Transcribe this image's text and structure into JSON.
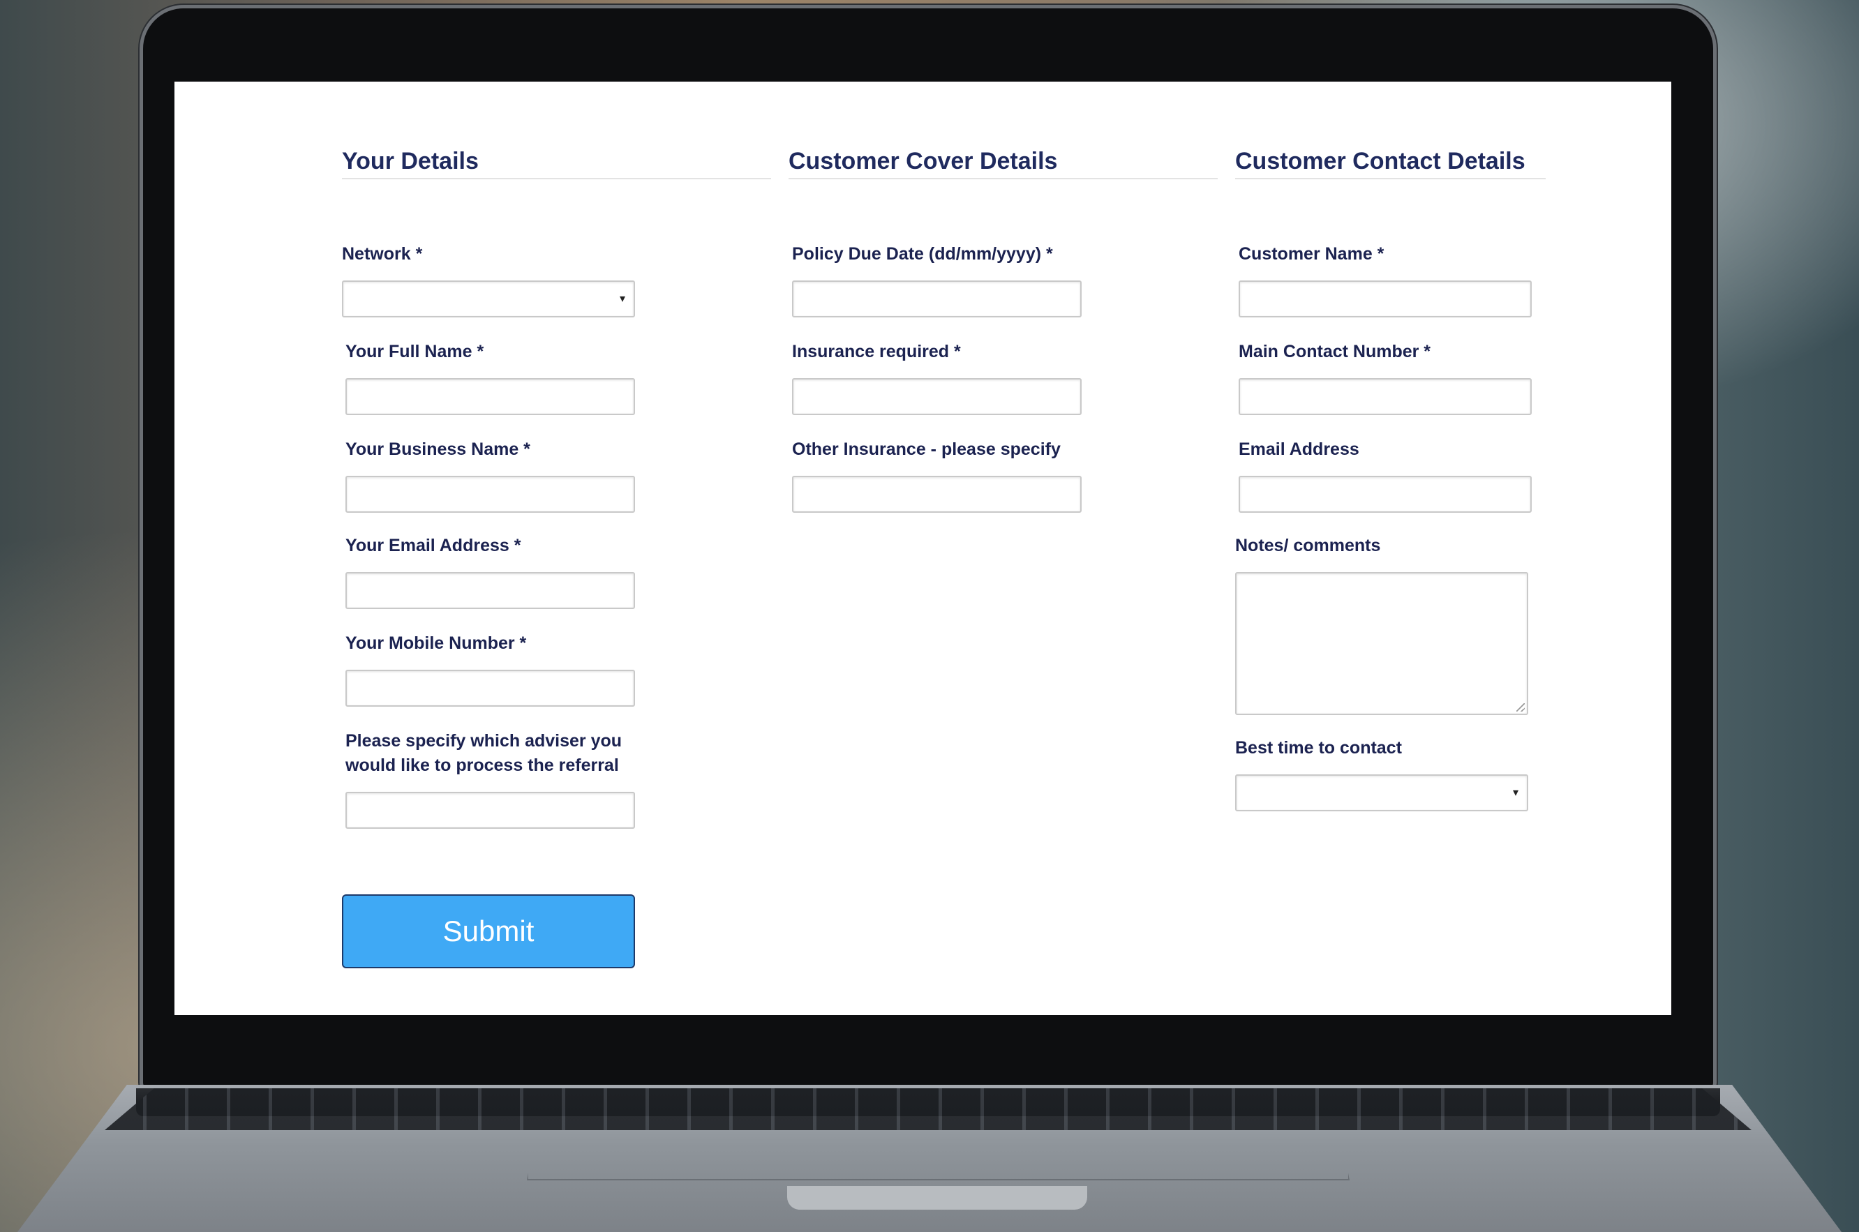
{
  "form": {
    "your_details": {
      "title": "Your Details",
      "network_label": "Network *",
      "network_value": "",
      "full_name_label": "Your Full Name *",
      "business_name_label": "Your Business Name *",
      "email_label": "Your Email Address *",
      "mobile_label": "Your Mobile Number *",
      "adviser_label_line1": "Please specify which adviser you",
      "adviser_label_line2": "would like to process the referral"
    },
    "cover_details": {
      "title": "Customer Cover Details",
      "policy_due_label": "Policy Due Date (dd/mm/yyyy) *",
      "insurance_required_label": "Insurance required *",
      "other_insurance_label": "Other Insurance - please specify"
    },
    "contact_details": {
      "title": "Customer Contact Details",
      "customer_name_label": "Customer Name *",
      "main_contact_label": "Main Contact Number *",
      "email_label": "Email Address",
      "notes_label": "Notes/ comments",
      "best_time_label": "Best time to contact",
      "best_time_value": ""
    },
    "submit_label": "Submit",
    "select_arrow_glyph": "▾"
  },
  "colors": {
    "heading": "#1f2a5e",
    "label": "#1b2250",
    "submit_bg": "#3fa9f5"
  }
}
